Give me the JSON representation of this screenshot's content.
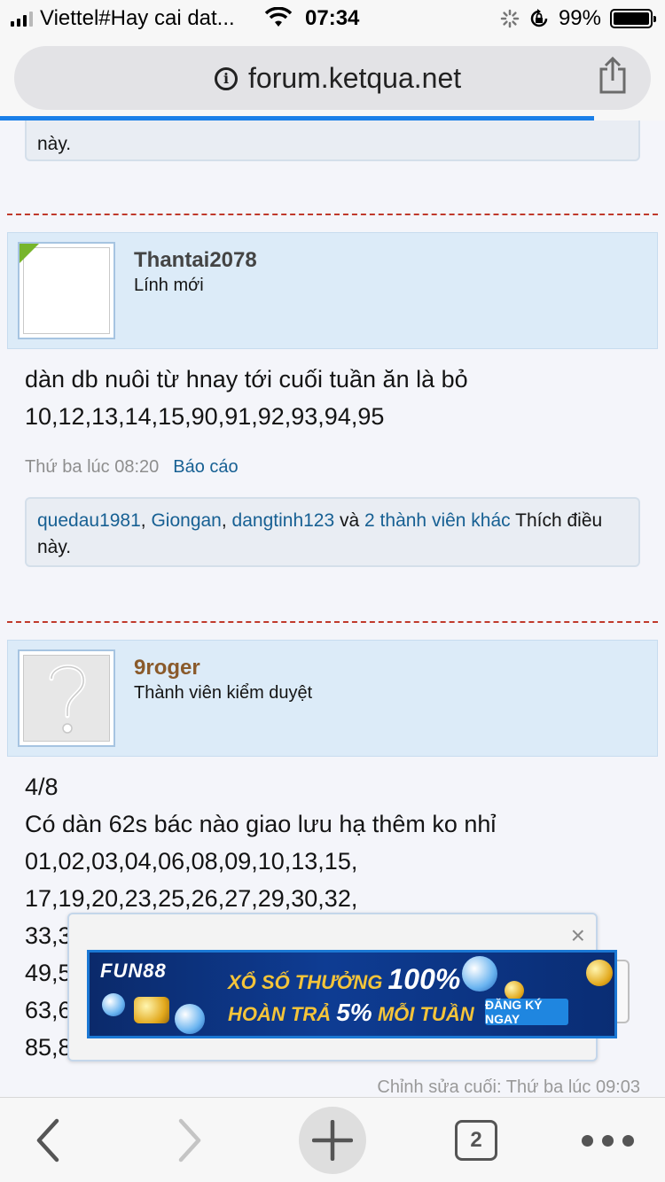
{
  "status_bar": {
    "carrier": "Viettel#Hay cai dat...",
    "time": "07:34",
    "battery": "99%"
  },
  "browser": {
    "url": "forum.ketqua.net",
    "tab_count": "2"
  },
  "posts": [
    {
      "likes_tail": "này."
    },
    {
      "username": "Thantai2078",
      "user_title": "Lính mới",
      "message_lines": [
        "dàn db nuôi từ hnay tới cuối tuần ăn là bỏ",
        "10,12,13,14,15,90,91,92,93,94,95"
      ],
      "timestamp": "Thứ ba lúc 08:20",
      "report_label": "Báo cáo",
      "likers": [
        "quedau1981",
        "Giongan",
        "dangtinh123"
      ],
      "likes_and": "và",
      "likes_others": "2 thành viên khác",
      "likes_suffix": "Thích điều",
      "likes_suffix2": "này."
    },
    {
      "username": "9roger",
      "user_title": "Thành viên kiểm duyệt",
      "message_lines": [
        "4/8",
        "Có dàn 62s bác nào giao lưu hạ thêm ko nhỉ",
        "01,02,03,04,06,08,09,10,13,15,",
        "17,19,20,23,25,26,27,29,30,32,",
        "33,3",
        "49,5",
        "63,6",
        "85,8"
      ],
      "edit_note": "Chỉnh sửa cuối: Thứ ba lúc 09:03"
    }
  ],
  "ad": {
    "close": "×",
    "brand": "FUN88",
    "line1_text": "XỔ SỐ THƯỞNG",
    "line1_highlight": "100%",
    "line2_text": "HOÀN TRẢ",
    "line2_highlight": "5%",
    "line2_tail": "MỖI TUẦN",
    "cta": "ĐĂNG KÝ NGAY"
  }
}
